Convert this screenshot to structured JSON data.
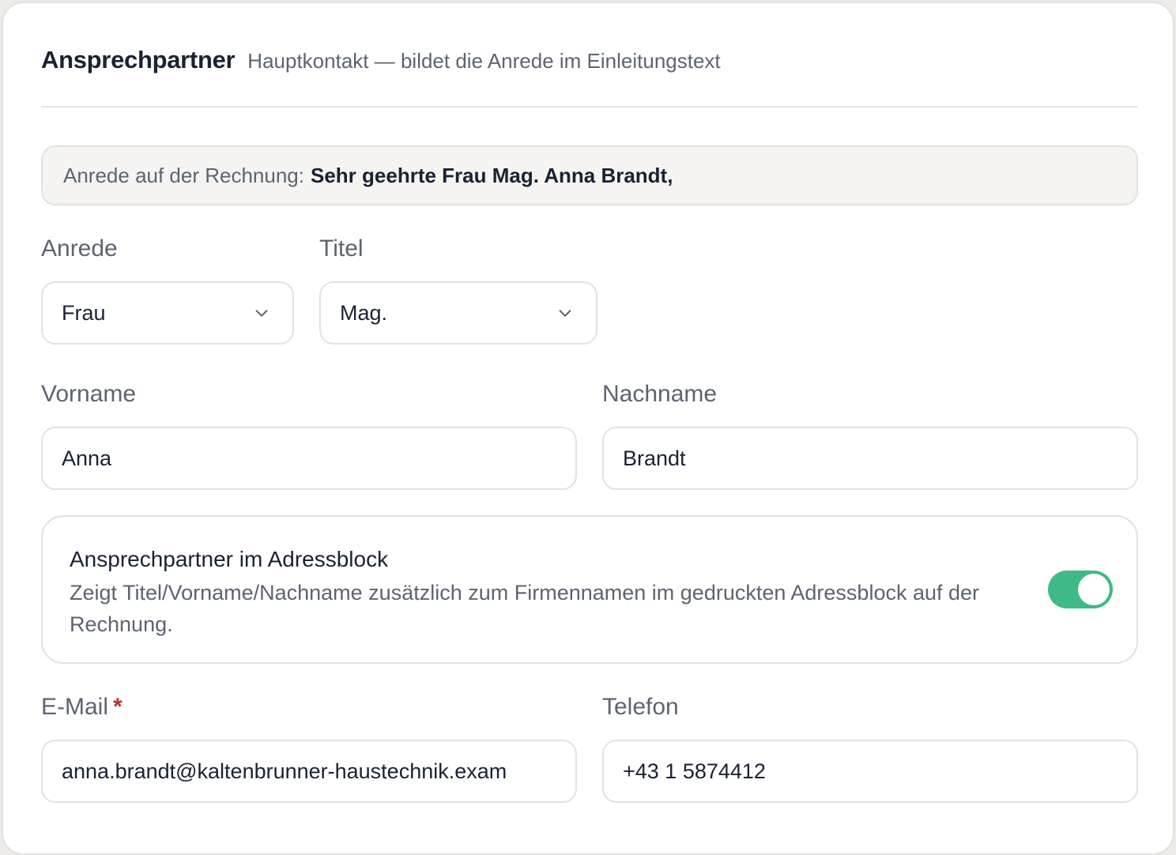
{
  "section": {
    "title": "Ansprechpartner",
    "subtitle": "Hauptkontakt — bildet die Anrede im Einleitungstext"
  },
  "preview": {
    "label": "Anrede auf der Rechnung:",
    "value": "Sehr geehrte Frau Mag. Anna Brandt,"
  },
  "fields": {
    "anrede": {
      "label": "Anrede",
      "value": "Frau"
    },
    "titel": {
      "label": "Titel",
      "value": "Mag."
    },
    "vorname": {
      "label": "Vorname",
      "value": "Anna"
    },
    "nachname": {
      "label": "Nachname",
      "value": "Brandt"
    },
    "email": {
      "label": "E-Mail",
      "required_mark": "*",
      "value": "anna.brandt@kaltenbrunner-haustechnik.exam"
    },
    "telefon": {
      "label": "Telefon",
      "value": "+43 1 5874412"
    }
  },
  "address_toggle": {
    "title": "Ansprechpartner im Adressblock",
    "description": "Zeigt Titel/Vorname/Nachname zusätzlich zum Firmennamen im gedruckten Adressblock auf der Rechnung.",
    "enabled": true,
    "on_color": "#3dba86"
  },
  "icons": {
    "select_chevron": "chevron-down-icon"
  }
}
